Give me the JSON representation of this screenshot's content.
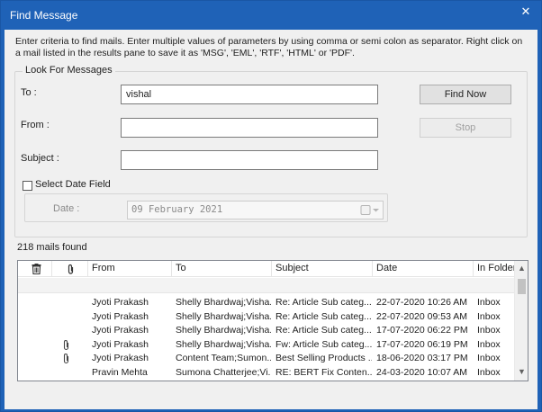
{
  "window": {
    "title": "Find Message",
    "close_glyph": "✕"
  },
  "instructions": "Enter criteria to find mails. Enter multiple values of parameters by using comma or semi colon as separator. Right click on a mail listed in the results pane to save it as 'MSG', 'EML', 'RTF', 'HTML' or 'PDF'.",
  "search": {
    "group_label": "Look For Messages",
    "to_label": "To :",
    "to_value": "vishal",
    "from_label": "From :",
    "from_value": "",
    "subject_label": "Subject :",
    "subject_value": "",
    "date_checkbox_label": "Select Date Field",
    "date_checked": false,
    "date_label": "Date :",
    "date_value": "09  February  2021",
    "find_button": "Find Now",
    "stop_button": "Stop"
  },
  "results": {
    "count_text": "218 mails found",
    "columns": {
      "delete_icon": "trash-icon",
      "attachment_icon": "paperclip-icon",
      "from": "From",
      "to": "To",
      "subject": "Subject",
      "date": "Date",
      "folder": "In Folder"
    },
    "rows": [
      {
        "attachment": false,
        "from": "Jyoti Prakash",
        "to": "Shelly Bhardwaj;Visha...",
        "subject": "Re: Article Sub categ...",
        "date": "22-07-2020 10:26 AM",
        "folder": "Inbox"
      },
      {
        "attachment": false,
        "from": "Jyoti Prakash",
        "to": "Shelly Bhardwaj;Visha...",
        "subject": "Re: Article Sub categ...",
        "date": "22-07-2020 09:53 AM",
        "folder": "Inbox"
      },
      {
        "attachment": false,
        "from": "Jyoti Prakash",
        "to": "Shelly Bhardwaj;Visha...",
        "subject": "Re: Article Sub categ...",
        "date": "17-07-2020 06:22 PM",
        "folder": "Inbox"
      },
      {
        "attachment": true,
        "from": "Jyoti Prakash",
        "to": "Shelly Bhardwaj;Visha...",
        "subject": "Fw: Article Sub categ...",
        "date": "17-07-2020 06:19 PM",
        "folder": "Inbox"
      },
      {
        "attachment": true,
        "from": "Jyoti Prakash",
        "to": "Content Team;Sumon...",
        "subject": "Best Selling Products ...",
        "date": "18-06-2020 03:17 PM",
        "folder": "Inbox"
      },
      {
        "attachment": false,
        "from": "Pravin Mehta",
        "to": "Sumona Chatterjee;Vi...",
        "subject": "RE: BERT Fix Conten...",
        "date": "24-03-2020 10:07 AM",
        "folder": "Inbox"
      }
    ]
  },
  "colors": {
    "titlebar": "#1f62b7",
    "client": "#f0f0f0"
  }
}
